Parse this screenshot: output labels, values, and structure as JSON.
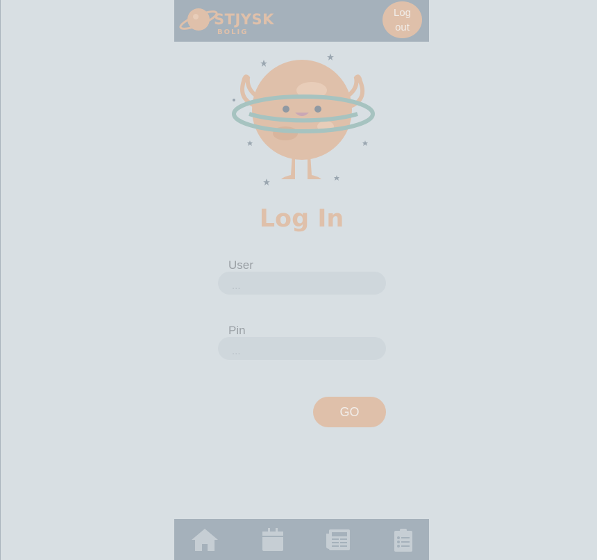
{
  "header": {
    "logo_text": "STJYSK",
    "logo_subtext": "BOLIG",
    "logout_label": "Log\nout"
  },
  "main": {
    "title": "Log In",
    "user_label": "User",
    "user_placeholder": "...",
    "pin_label": "Pin",
    "pin_placeholder": "...",
    "go_label": "GO"
  },
  "bottom_nav": {
    "items": [
      {
        "icon": "home-icon"
      },
      {
        "icon": "calendar-icon"
      },
      {
        "icon": "newspaper-icon"
      },
      {
        "icon": "clipboard-list-icon"
      }
    ]
  },
  "colors": {
    "background": "#d8dfe3",
    "bar": "#a5b1bb",
    "accent": "#dfc0aa",
    "field": "#cfd7dc"
  }
}
